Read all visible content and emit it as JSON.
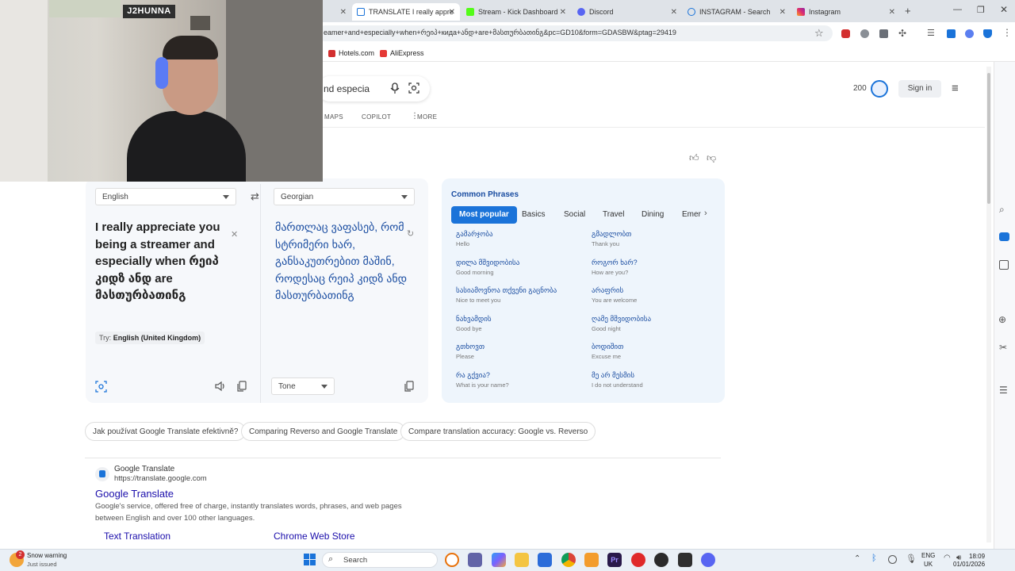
{
  "browser": {
    "tabs": [
      {
        "label": "TRANSLATE I really appre",
        "active": true,
        "color": "#1a73d9"
      },
      {
        "label": "Stream - Kick Dashboard",
        "color": "#53fc18"
      },
      {
        "label": "Discord",
        "color": "#5865f2"
      },
      {
        "label": "INSTAGRAM - Search",
        "color": "#1a73d9"
      },
      {
        "label": "Instagram",
        "color": "#e1306c"
      }
    ],
    "url": "eamer+and+especially+when+რეიპ+кида+ანდ+are+მასთურბათინგ&pc=GD10&form=GDASBW&ptag=29419",
    "bookmarks": [
      {
        "label": "Hotels.com",
        "color": "#d32f2f"
      },
      {
        "label": "AliExpress",
        "color": "#e53935"
      }
    ]
  },
  "bing": {
    "search_value": "nd especia",
    "nav": [
      "MAPS",
      "COPILOT",
      "MORE"
    ],
    "rewards_points": "200",
    "sign_in": "Sign in"
  },
  "translator": {
    "source_lang": "English",
    "target_lang": "Georgian",
    "source_text": "I really appreciate you being a streamer and especially when რეიპ კიდზ ანდ are მასთურბათინგ",
    "target_text": "მართლაც ვაფასებ, რომ სტრიმერი ხარ, განსაკუთრებით მაშინ, როდესაც რეიპ კიდზ ანდ მასთურბათინგ",
    "try_prefix": "Try:",
    "try_suggestion": "English (United Kingdom)",
    "tone_label": "Tone"
  },
  "phrases": {
    "title": "Common Phrases",
    "tabs": [
      "Most popular",
      "Basics",
      "Social",
      "Travel",
      "Dining",
      "Emer"
    ],
    "items": [
      {
        "ka": "გამარჯობა",
        "en": "Hello"
      },
      {
        "ka": "გმადლობთ",
        "en": "Thank you"
      },
      {
        "ka": "დილა მშვიდობისა",
        "en": "Good morning"
      },
      {
        "ka": "როგორ ხარ?",
        "en": "How are you?"
      },
      {
        "ka": "სასიამოვნოა თქვენი გაცნობა",
        "en": "Nice to meet you"
      },
      {
        "ka": "არაფრის",
        "en": "You are welcome"
      },
      {
        "ka": "ნახვამდის",
        "en": "Good bye"
      },
      {
        "ka": "ღამე მშვიდობისა",
        "en": "Good night"
      },
      {
        "ka": "გთხოვთ",
        "en": "Please"
      },
      {
        "ka": "ბოდიშით",
        "en": "Excuse me"
      },
      {
        "ka": "რა გქვია?",
        "en": "What is your name?"
      },
      {
        "ka": "მე არ მესმის",
        "en": "I do not understand"
      }
    ]
  },
  "related": [
    "Jak používat Google Translate efektivně?",
    "Comparing Reverso and Google Translate",
    "Compare translation accuracy: Google vs. Reverso"
  ],
  "result": {
    "site_name": "Google Translate",
    "site_url": "https://translate.google.com",
    "title": "Google Translate",
    "snippet_1": "Google's service, offered free of charge, instantly translates words, phrases, and web pages",
    "snippet_2": "between English and over 100 other languages.",
    "sublinks": [
      "Text Translation",
      "Chrome Web Store"
    ]
  },
  "webcam": {
    "streamer_name": "J2HUNNA"
  },
  "taskbar": {
    "weather_title": "Snow warning",
    "weather_sub": "Just issued",
    "weather_badge": "2",
    "search_label": "Search",
    "lang_top": "ENG",
    "lang_bottom": "UK",
    "time": "18:09",
    "date": "01/01/2026"
  }
}
